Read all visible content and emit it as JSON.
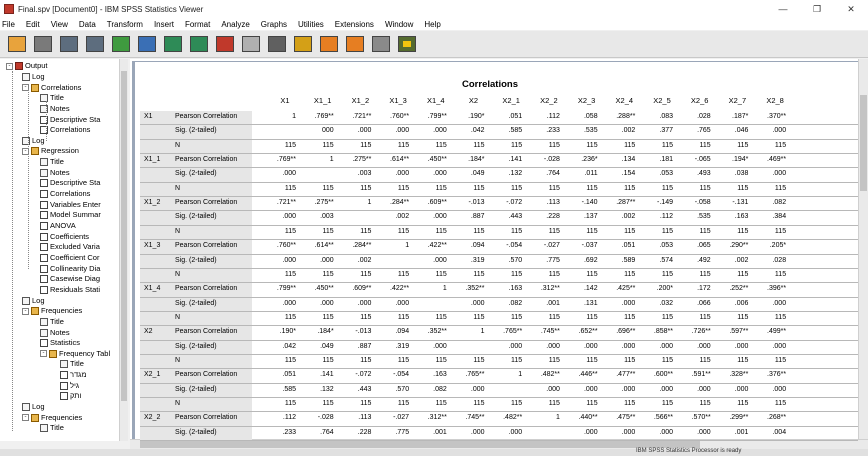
{
  "window": {
    "title": "Final.spv [Document0] - IBM SPSS Statistics Viewer",
    "controls": [
      "—",
      "❐",
      "✕"
    ]
  },
  "menu": [
    "File",
    "Edit",
    "View",
    "Data",
    "Transform",
    "Insert",
    "Format",
    "Analyze",
    "Graphs",
    "Utilities",
    "Extensions",
    "Window",
    "Help"
  ],
  "toolbar_icons": [
    "open-folder-icon",
    "save-icon",
    "print-icon",
    "print-preview-icon",
    "export-icon",
    "recall-dialog-icon",
    "undo-icon",
    "redo-icon",
    "goto-data-icon",
    "goto-case-icon",
    "goto-variable-icon",
    "variables-icon",
    "insert-output-icon",
    "designate-window-icon",
    "show-hide-icon",
    "select-last-output-icon"
  ],
  "outline": [
    {
      "label": "Output",
      "level": 0,
      "icon": "sec",
      "expander": "-"
    },
    {
      "label": "Log",
      "level": 1,
      "icon": "doc",
      "expander": ""
    },
    {
      "label": "Correlations",
      "level": 1,
      "icon": "book",
      "expander": "-"
    },
    {
      "label": "Title",
      "level": 2,
      "icon": "doc",
      "expander": ""
    },
    {
      "label": "Notes",
      "level": 2,
      "icon": "doc",
      "expander": ""
    },
    {
      "label": "Descriptive Sta",
      "level": 2,
      "icon": "tab",
      "expander": ""
    },
    {
      "label": "Correlations",
      "level": 2,
      "icon": "tab",
      "expander": ""
    },
    {
      "label": "Log",
      "level": 1,
      "icon": "doc",
      "expander": ""
    },
    {
      "label": "Regression",
      "level": 1,
      "icon": "book",
      "expander": "-"
    },
    {
      "label": "Title",
      "level": 2,
      "icon": "doc",
      "expander": ""
    },
    {
      "label": "Notes",
      "level": 2,
      "icon": "doc",
      "expander": ""
    },
    {
      "label": "Descriptive Sta",
      "level": 2,
      "icon": "tab",
      "expander": ""
    },
    {
      "label": "Correlations",
      "level": 2,
      "icon": "tab",
      "expander": ""
    },
    {
      "label": "Variables Enter",
      "level": 2,
      "icon": "tab",
      "expander": ""
    },
    {
      "label": "Model Summar",
      "level": 2,
      "icon": "tab",
      "expander": ""
    },
    {
      "label": "ANOVA",
      "level": 2,
      "icon": "tab",
      "expander": ""
    },
    {
      "label": "Coefficients",
      "level": 2,
      "icon": "tab",
      "expander": ""
    },
    {
      "label": "Excluded Varia",
      "level": 2,
      "icon": "tab",
      "expander": ""
    },
    {
      "label": "Coefficient Cor",
      "level": 2,
      "icon": "tab",
      "expander": ""
    },
    {
      "label": "Collinearity Dia",
      "level": 2,
      "icon": "tab",
      "expander": ""
    },
    {
      "label": "Casewise Diag",
      "level": 2,
      "icon": "tab",
      "expander": ""
    },
    {
      "label": "Residuals Stati",
      "level": 2,
      "icon": "tab",
      "expander": ""
    },
    {
      "label": "Log",
      "level": 1,
      "icon": "doc",
      "expander": ""
    },
    {
      "label": "Frequencies",
      "level": 1,
      "icon": "book",
      "expander": "-"
    },
    {
      "label": "Title",
      "level": 2,
      "icon": "doc",
      "expander": ""
    },
    {
      "label": "Notes",
      "level": 2,
      "icon": "doc",
      "expander": ""
    },
    {
      "label": "Statistics",
      "level": 2,
      "icon": "tab",
      "expander": ""
    },
    {
      "label": "Frequency Tabl",
      "level": 2,
      "icon": "book",
      "expander": "-"
    },
    {
      "label": "Title",
      "level": 3,
      "icon": "doc",
      "expander": ""
    },
    {
      "label": "מגדר",
      "level": 3,
      "icon": "tab",
      "expander": ""
    },
    {
      "label": "גיל",
      "level": 3,
      "icon": "tab",
      "expander": ""
    },
    {
      "label": "ותק",
      "level": 3,
      "icon": "tab",
      "expander": ""
    },
    {
      "label": "Log",
      "level": 1,
      "icon": "doc",
      "expander": ""
    },
    {
      "label": "Frequencies",
      "level": 1,
      "icon": "book",
      "expander": "-"
    },
    {
      "label": "Title",
      "level": 2,
      "icon": "doc",
      "expander": ""
    }
  ],
  "table": {
    "title": "Correlations",
    "columns": [
      "X1",
      "X1_1",
      "X1_2",
      "X1_3",
      "X1_4",
      "X2",
      "X2_1",
      "X2_2",
      "X2_3",
      "X2_4",
      "X2_5",
      "X2_6",
      "X2_7",
      "X2_8"
    ],
    "stat_labels": [
      "Pearson Correlation",
      "Sig. (2-tailed)",
      "N"
    ],
    "rows": [
      {
        "var": "X1",
        "values": [
          [
            "1",
            ".769**",
            ".721**",
            ".760**",
            ".799**",
            ".190*",
            ".051",
            ".112",
            ".058",
            ".288**",
            ".083",
            ".028",
            ".187*",
            ".370**"
          ],
          [
            "",
            "000",
            ".000",
            ".000",
            ".000",
            ".042",
            ".585",
            ".233",
            ".535",
            ".002",
            ".377",
            ".765",
            ".046",
            ".000"
          ],
          [
            "115",
            "115",
            "115",
            "115",
            "115",
            "115",
            "115",
            "115",
            "115",
            "115",
            "115",
            "115",
            "115",
            "115"
          ]
        ]
      },
      {
        "var": "X1_1",
        "values": [
          [
            ".769**",
            "1",
            ".275**",
            ".614**",
            ".450**",
            ".184*",
            ".141",
            "-.028",
            ".236*",
            ".134",
            ".181",
            "-.065",
            ".194*",
            ".469**"
          ],
          [
            ".000",
            "",
            ".003",
            ".000",
            ".000",
            ".049",
            ".132",
            ".764",
            ".011",
            ".154",
            ".053",
            ".493",
            ".038",
            ".000"
          ],
          [
            "115",
            "115",
            "115",
            "115",
            "115",
            "115",
            "115",
            "115",
            "115",
            "115",
            "115",
            "115",
            "115",
            "115"
          ]
        ]
      },
      {
        "var": "X1_2",
        "values": [
          [
            ".721**",
            ".275**",
            "1",
            ".284**",
            ".609**",
            "-.013",
            "-.072",
            ".113",
            "-.140",
            ".287**",
            "-.149",
            "-.058",
            "-.131",
            ".082"
          ],
          [
            ".000",
            ".003",
            "",
            ".002",
            ".000",
            ".887",
            ".443",
            ".228",
            ".137",
            ".002",
            ".112",
            ".535",
            ".163",
            ".384"
          ],
          [
            "115",
            "115",
            "115",
            "115",
            "115",
            "115",
            "115",
            "115",
            "115",
            "115",
            "115",
            "115",
            "115",
            "115"
          ]
        ]
      },
      {
        "var": "X1_3",
        "values": [
          [
            ".760**",
            ".614**",
            ".284**",
            "1",
            ".422**",
            ".094",
            "-.054",
            "-.027",
            "-.037",
            ".051",
            ".053",
            ".065",
            ".290**",
            ".205*"
          ],
          [
            ".000",
            ".000",
            ".002",
            "",
            ".000",
            ".319",
            ".570",
            ".775",
            ".692",
            ".589",
            ".574",
            ".492",
            ".002",
            ".028"
          ],
          [
            "115",
            "115",
            "115",
            "115",
            "115",
            "115",
            "115",
            "115",
            "115",
            "115",
            "115",
            "115",
            "115",
            "115"
          ]
        ]
      },
      {
        "var": "X1_4",
        "values": [
          [
            ".799**",
            ".450**",
            ".609**",
            ".422**",
            "1",
            ".352**",
            ".163",
            ".312**",
            ".142",
            ".425**",
            ".200*",
            ".172",
            ".252**",
            ".396**"
          ],
          [
            ".000",
            ".000",
            ".000",
            ".000",
            "",
            ".000",
            ".082",
            ".001",
            ".131",
            ".000",
            ".032",
            ".066",
            ".006",
            ".000"
          ],
          [
            "115",
            "115",
            "115",
            "115",
            "115",
            "115",
            "115",
            "115",
            "115",
            "115",
            "115",
            "115",
            "115",
            "115"
          ]
        ]
      },
      {
        "var": "X2",
        "values": [
          [
            ".190*",
            ".184*",
            "-.013",
            ".094",
            ".352**",
            "1",
            ".765**",
            ".745**",
            ".652**",
            ".696**",
            ".858**",
            ".726**",
            ".597**",
            ".499**"
          ],
          [
            ".042",
            ".049",
            ".887",
            ".319",
            ".000",
            "",
            ".000",
            ".000",
            ".000",
            ".000",
            ".000",
            ".000",
            ".000",
            ".000"
          ],
          [
            "115",
            "115",
            "115",
            "115",
            "115",
            "115",
            "115",
            "115",
            "115",
            "115",
            "115",
            "115",
            "115",
            "115"
          ]
        ]
      },
      {
        "var": "X2_1",
        "values": [
          [
            ".051",
            ".141",
            "-.072",
            "-.054",
            ".163",
            ".765**",
            "1",
            ".482**",
            ".446**",
            ".477**",
            ".600**",
            ".591**",
            ".328**",
            ".376**"
          ],
          [
            ".585",
            ".132",
            ".443",
            ".570",
            ".082",
            ".000",
            "",
            ".000",
            ".000",
            ".000",
            ".000",
            ".000",
            ".000",
            ".000"
          ],
          [
            "115",
            "115",
            "115",
            "115",
            "115",
            "115",
            "115",
            "115",
            "115",
            "115",
            "115",
            "115",
            "115",
            "115"
          ]
        ]
      },
      {
        "var": "X2_2",
        "values": [
          [
            ".112",
            "-.028",
            ".113",
            "-.027",
            ".312**",
            ".745**",
            ".482**",
            "1",
            ".440**",
            ".475**",
            ".566**",
            ".570**",
            ".299**",
            ".268**"
          ],
          [
            ".233",
            ".764",
            ".228",
            ".775",
            ".001",
            ".000",
            ".000",
            "",
            ".000",
            ".000",
            ".000",
            ".000",
            ".001",
            ".004"
          ]
        ]
      }
    ]
  },
  "status": "IBM SPSS Statistics Processor is ready"
}
